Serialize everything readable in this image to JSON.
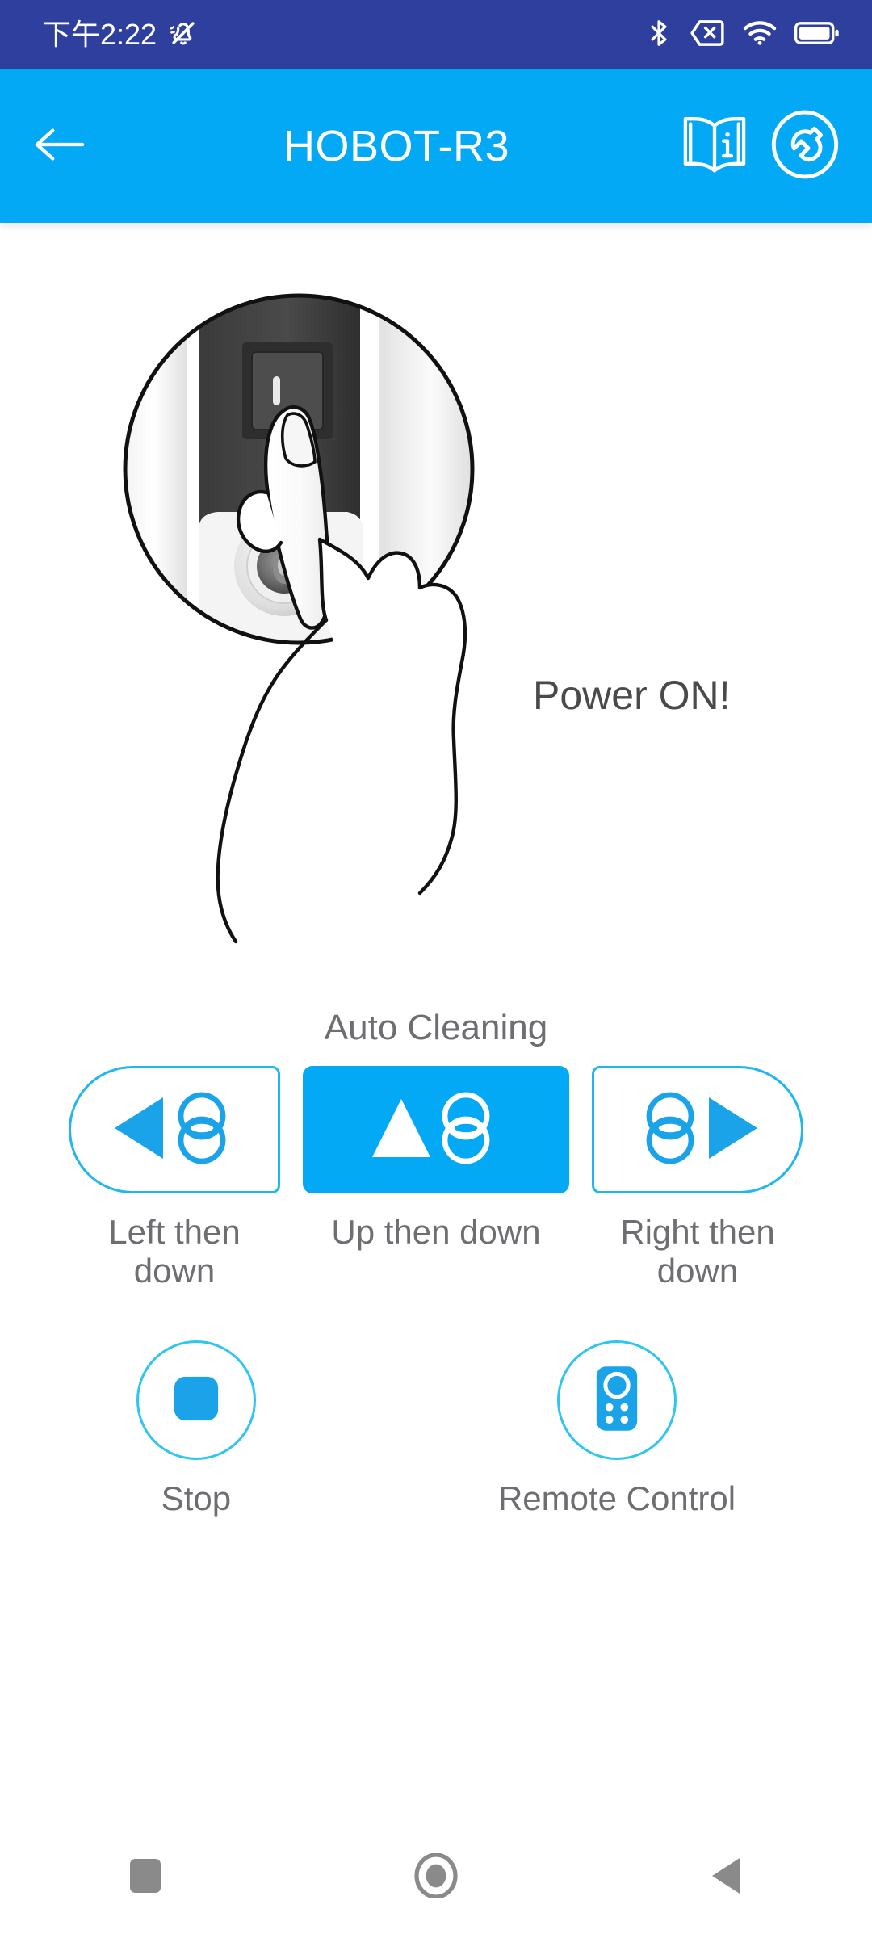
{
  "status_bar": {
    "background": "#2F3F9E",
    "clock": "下午2:22",
    "icons": {
      "silent": "bell-muted-icon",
      "bluetooth": "bluetooth-icon",
      "sim": "no-sim-icon",
      "wifi": "wifi-icon",
      "battery": "battery-full-icon"
    }
  },
  "app_bar": {
    "background": "#03A9F4",
    "title": "HOBOT-R3",
    "back_icon": "arrow-left-icon",
    "manual_icon": "book-info-icon",
    "settings_icon": "wrench-circle-icon"
  },
  "hero": {
    "caption": "Power ON!",
    "illustration": "hand-pressing-power-switch-illustration"
  },
  "auto_cleaning": {
    "title": "Auto Cleaning",
    "accent": "#03A9F4",
    "border_accent": "#22b6ef",
    "buttons": [
      {
        "key": "left-then-down",
        "label": "Left then down",
        "icon": "arrow-left-cleaning-path-icon",
        "selected": false
      },
      {
        "key": "up-then-down",
        "label": "Up then down",
        "icon": "arrow-up-cleaning-path-icon",
        "selected": true
      },
      {
        "key": "right-then-down",
        "label": "Right then down",
        "icon": "arrow-right-cleaning-path-icon",
        "selected": false
      }
    ]
  },
  "controls": [
    {
      "key": "stop",
      "label": "Stop",
      "icon": "stop-square-icon"
    },
    {
      "key": "remote-control",
      "label": "Remote Control",
      "icon": "remote-control-icon"
    }
  ],
  "nav_bar": {
    "recents_icon": "square-recents-icon",
    "home_icon": "circle-home-icon",
    "back_icon": "triangle-back-icon"
  }
}
